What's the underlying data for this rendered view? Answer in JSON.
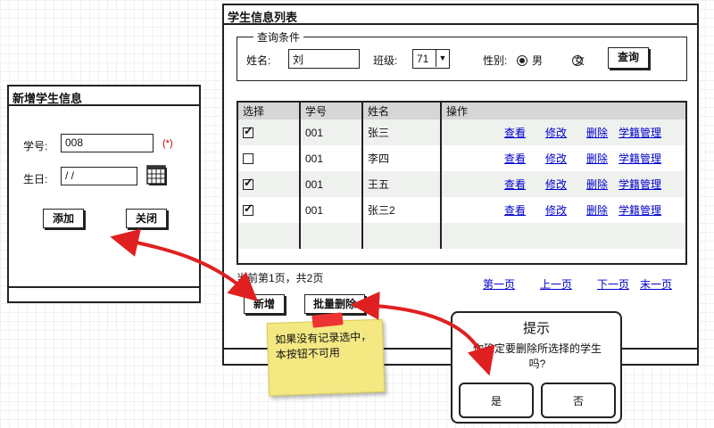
{
  "main_window": {
    "title": "学生信息列表",
    "query_group": {
      "legend": "查询条件",
      "name_label": "姓名:",
      "name_value": "刘",
      "class_label": "班级:",
      "class_value": "71",
      "gender_label": "性别:",
      "gender_male": "男",
      "gender_female": "女",
      "gender_selected": "男",
      "query_button": "查询"
    },
    "table": {
      "headers": [
        "选择",
        "学号",
        "姓名",
        "操作"
      ],
      "rows": [
        {
          "checked": true,
          "id": "001",
          "name": "张三"
        },
        {
          "checked": false,
          "id": "001",
          "name": "李四"
        },
        {
          "checked": true,
          "id": "001",
          "name": "王五"
        },
        {
          "checked": true,
          "id": "001",
          "name": "张三2"
        }
      ],
      "actions": [
        "查看",
        "修改",
        "删除",
        "学籍管理"
      ]
    },
    "page_info": "当前第1页，共2页",
    "pager": {
      "first": "第一页",
      "prev": "上一页",
      "next": "下一页",
      "last": "末一页"
    },
    "add_button": "新增",
    "batch_delete_button": "批量删除"
  },
  "add_form": {
    "title": "新增学生信息",
    "student_id_label": "学号:",
    "student_id_value": "008",
    "required_mark": "(*)",
    "birthday_label": "生日:",
    "birthday_value": "/ /",
    "add_button": "添加",
    "close_button": "关闭"
  },
  "sticky_note": {
    "text": "如果没有记录选中，本按钮不可用"
  },
  "confirm_dialog": {
    "title": "提示",
    "message": "你确定要删除所选择的学生吗?",
    "yes": "是",
    "no": "否"
  },
  "colors": {
    "arrow": "#e02020",
    "header_bg": "#d6d6d6",
    "link": "#0000cc",
    "sticky": "#f3e882",
    "required": "#cc0000"
  }
}
